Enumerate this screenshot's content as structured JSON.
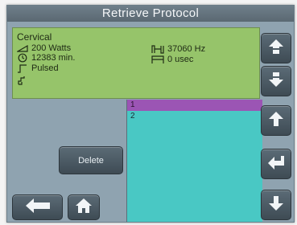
{
  "window": {
    "title": "Retrieve Protocol"
  },
  "protocol": {
    "name": "Cervical",
    "power": "200 Watts",
    "time": "12383 min.",
    "mode": "Pulsed",
    "frequency": "37060 Hz",
    "delay": "0 usec"
  },
  "list": {
    "items": [
      {
        "label": "1",
        "selected": true
      },
      {
        "label": "2",
        "selected": false
      }
    ]
  },
  "buttons": {
    "delete": "Delete"
  },
  "icons": {
    "page_up": "double-up-arrow-icon",
    "page_down": "double-down-arrow-icon",
    "up": "up-arrow-icon",
    "enter": "enter-arrow-icon",
    "down": "down-arrow-icon",
    "back": "back-arrow-icon",
    "home": "home-icon"
  },
  "colors": {
    "info_panel": "#96c46a",
    "list_background": "#49c8c4",
    "selected_row": "#9b55b4",
    "screen": "#8fa3b0"
  }
}
